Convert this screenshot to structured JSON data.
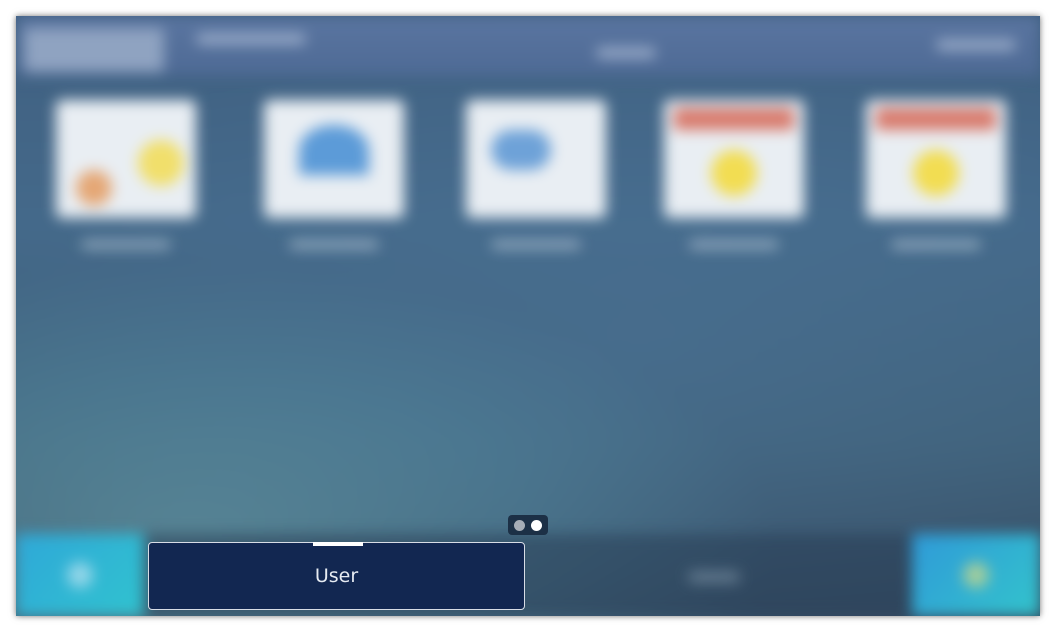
{
  "user_button": {
    "label": "User"
  },
  "pager": {
    "total": 2,
    "active_index": 1
  },
  "colors": {
    "button_background": "#122751",
    "button_border": "#d8dde6",
    "pager_active": "#ffffff",
    "pager_inactive": "#a6adb6"
  }
}
